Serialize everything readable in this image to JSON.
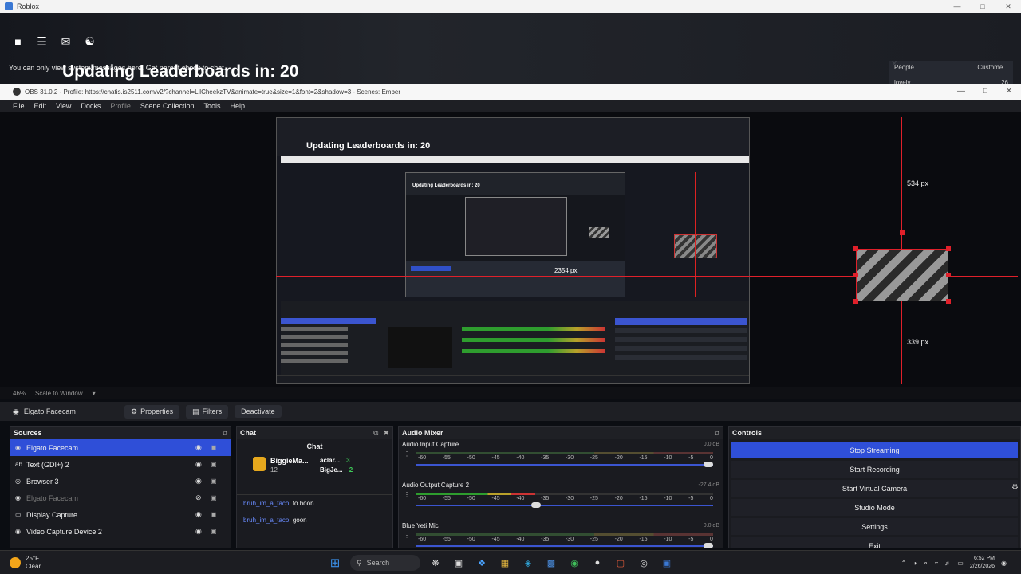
{
  "roblox": {
    "window_title": "Roblox",
    "system_message": "You can only view system messages here. Get parent check to chat.",
    "leaderboard_text": "Updating Leaderboards in: 20",
    "people_label": "People",
    "customers_label": "Custome...",
    "people_row_name": "lovely",
    "people_row_value": "26"
  },
  "obs": {
    "title": "OBS 31.0.2 - Profile: https://chatis.is2511.com/v2/?channel=LilCheekzTV&animate=true&size=1&font=2&shadow=3 - Scenes: Ember",
    "menu": [
      "File",
      "Edit",
      "View",
      "Docks",
      "Profile",
      "Scene Collection",
      "Tools",
      "Help"
    ],
    "preview": {
      "nested_leaderboard": "Updating Leaderboards in: 20",
      "label_2354": "2354 px",
      "label_534": "534 px",
      "label_339": "339 px"
    },
    "zoom": {
      "level": "46%",
      "mode": "Scale to Window"
    },
    "source_toolbar": {
      "selected_source": "Elgato Facecam",
      "properties": "Properties",
      "filters": "Filters",
      "deactivate": "Deactivate"
    },
    "sources": {
      "title": "Sources",
      "items": [
        {
          "name": "Elgato Facecam",
          "icon": "camera-icon",
          "selected": true,
          "visible": true
        },
        {
          "name": "Text (GDI+) 2",
          "icon": "text-icon",
          "selected": false,
          "visible": true
        },
        {
          "name": "Browser 3",
          "icon": "globe-icon",
          "selected": false,
          "visible": true
        },
        {
          "name": "Elgato Facecam",
          "icon": "camera-icon",
          "selected": false,
          "visible": false
        },
        {
          "name": "Display Capture",
          "icon": "monitor-icon",
          "selected": false,
          "visible": true
        },
        {
          "name": "Video Capture Device 2",
          "icon": "camera-icon",
          "selected": false,
          "visible": true
        }
      ]
    },
    "chat": {
      "title": "Chat",
      "header": "Chat",
      "top_user": "BiggieMa...",
      "top_user_count": "12",
      "rank1_user": "aclar...",
      "rank1_value": "3",
      "rank2_user": "BigJe...",
      "rank2_value": "2",
      "messages": [
        {
          "user": "bruh_im_a_taco",
          "text": ": to hoon"
        },
        {
          "user": "bruh_im_a_taco",
          "text": ": goon"
        }
      ]
    },
    "mixer": {
      "title": "Audio Mixer",
      "channels": [
        {
          "name": "Audio Input Capture",
          "db": "0.0 dB",
          "knob": 1.0,
          "live": false
        },
        {
          "name": "Audio Output Capture 2",
          "db": "-27.4 dB",
          "knob": 0.4,
          "live": true
        },
        {
          "name": "Blue Yeti Mic",
          "db": "0.0 dB",
          "knob": 1.0,
          "live": false
        }
      ],
      "ticks": [
        "-60",
        "-55",
        "-50",
        "-45",
        "-40",
        "-35",
        "-30",
        "-25",
        "-20",
        "-15",
        "-10",
        "-5",
        "0"
      ]
    },
    "controls": {
      "title": "Controls",
      "buttons": [
        "Stop Streaming",
        "Start Recording",
        "Start Virtual Camera",
        "Studio Mode",
        "Settings",
        "Exit"
      ]
    }
  },
  "taskbar": {
    "temperature": "25°F",
    "condition": "Clear",
    "search_placeholder": "Search",
    "time": "6:52 PM",
    "date": "2/26/2026"
  },
  "colors": {
    "accent": "#2f4fd8",
    "guide": "#e0202a",
    "meter_green": "#2e9d2e"
  }
}
